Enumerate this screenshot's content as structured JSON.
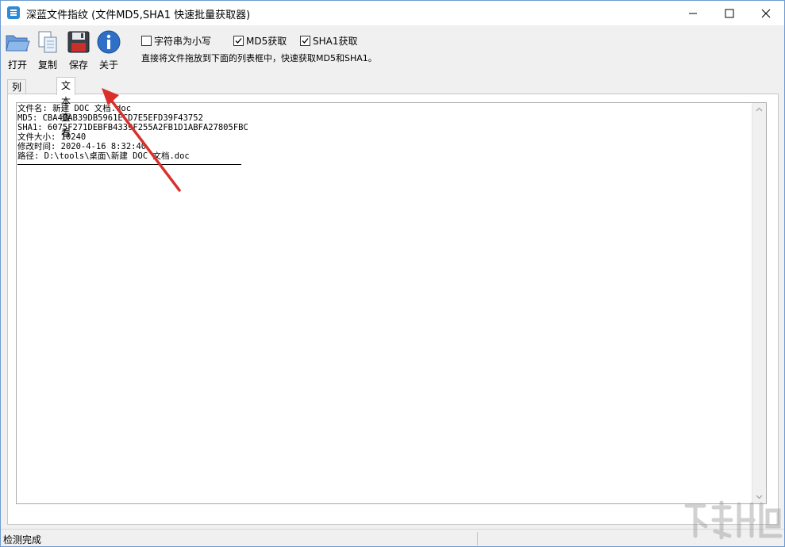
{
  "window": {
    "title": "深蓝文件指纹 (文件MD5,SHA1 快速批量获取器)"
  },
  "titlebar_buttons": [
    "minimize-icon",
    "maximize-icon",
    "close-icon"
  ],
  "toolbar": {
    "open_label": "打开",
    "copy_label": "复制",
    "save_label": "保存",
    "about_label": "关于"
  },
  "options": {
    "lowercase": {
      "label": "字符串为小写",
      "checked": false
    },
    "md5": {
      "label": "MD5获取",
      "checked": true
    },
    "sha1": {
      "label": "SHA1获取",
      "checked": true
    }
  },
  "hint": "直接将文件拖放到下面的列表框中，快速获取MD5和SHA1。",
  "tabs": [
    {
      "label": "列表查看",
      "active": false
    },
    {
      "label": "文本查看",
      "active": true
    }
  ],
  "text_view": {
    "lines": [
      "文件名: 新建 DOC 文档.doc",
      "MD5: CBA4BAB39DB5961ECD7E5EFD39F43752",
      "SHA1: 6075F271DEBFB4339F255A2FB1D1ABFA27805FBC",
      "文件大小: 10240",
      "修改时间: 2020-4-16 8:32:40",
      "路径: D:\\tools\\桌面\\新建 DOC 文档.doc"
    ]
  },
  "status": {
    "text": "检测完成"
  },
  "colors": {
    "accent": "#2d8ad8",
    "annotation_arrow": "#d9302b",
    "window_border": "#6f9bd1"
  }
}
